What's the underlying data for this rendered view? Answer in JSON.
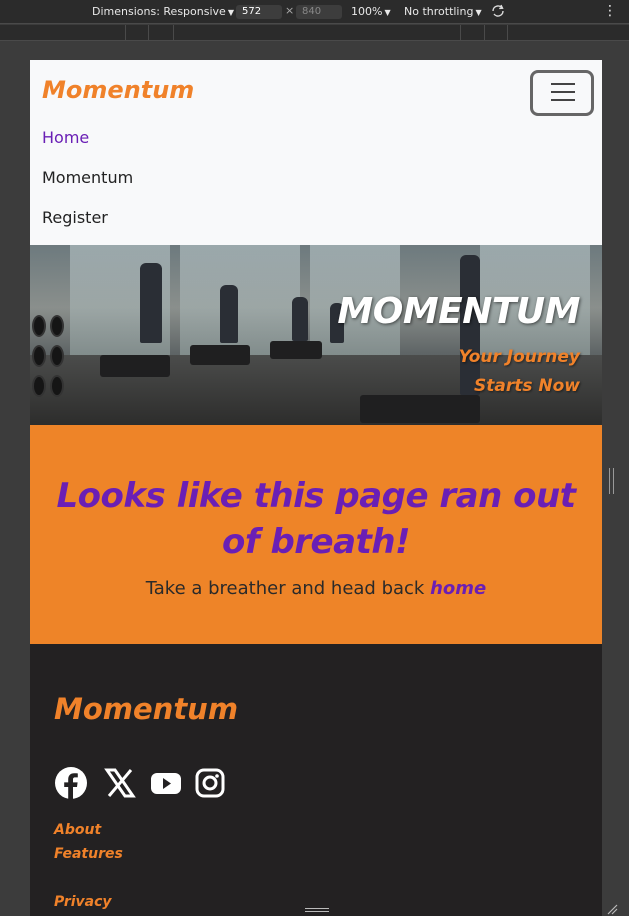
{
  "devtools": {
    "dimensions_label": "Dimensions: Responsive",
    "width": "572",
    "height_placeholder": "840",
    "zoom": "100%",
    "throttling": "No throttling"
  },
  "navbar": {
    "brand": "Momentum",
    "links": [
      "Home",
      "Momentum",
      "Register"
    ],
    "active_link": "Home"
  },
  "hero": {
    "title": "MOMENTUM",
    "subtitle_line1": "Your Journey",
    "subtitle_line2": "Starts Now"
  },
  "error": {
    "title": "Looks like this page ran out of breath!",
    "text": "Take a breather and head back",
    "link": "home"
  },
  "footer": {
    "brand": "Momentum",
    "social_icons": [
      "facebook-icon",
      "x-twitter-icon",
      "youtube-icon",
      "instagram-icon"
    ],
    "links": [
      "About",
      "Features",
      "Privacy"
    ]
  },
  "colors": {
    "accent_orange": "#f0822a",
    "accent_purple": "#6a1fb5",
    "footer_bg": "#232122",
    "navbar_bg": "#f8f9fa"
  }
}
